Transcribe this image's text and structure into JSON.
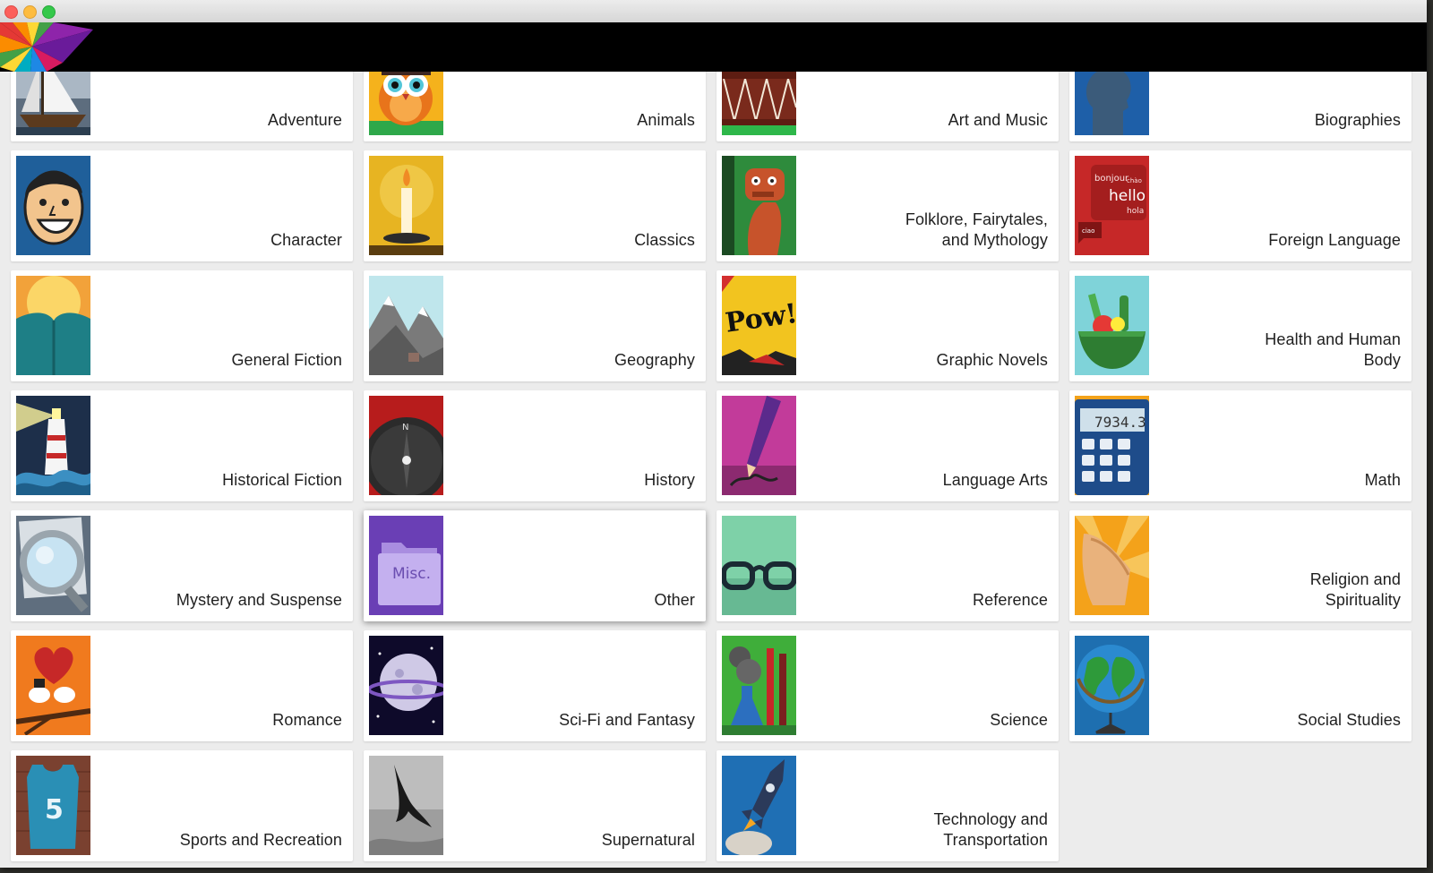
{
  "window": {
    "buttons": [
      "close",
      "minimize",
      "zoom"
    ]
  },
  "header": {
    "logo_icon": "rainbow-pinwheel-logo-icon"
  },
  "categories": [
    {
      "label": "Adventure",
      "icon": "ship-icon"
    },
    {
      "label": "Animals",
      "icon": "owl-icon"
    },
    {
      "label": "Art and Music",
      "icon": "drum-icon"
    },
    {
      "label": "Biographies",
      "icon": "head-silhouette-icon"
    },
    {
      "label": "Character",
      "icon": "smiling-face-icon"
    },
    {
      "label": "Classics",
      "icon": "candle-icon"
    },
    {
      "label": "Folklore, Fairytales,\nand Mythology",
      "icon": "dragon-icon"
    },
    {
      "label": "Foreign Language",
      "icon": "speech-bubble-hello-icon",
      "icon_words": [
        "bonjour",
        "chào",
        "hello",
        "hola",
        "ciao"
      ]
    },
    {
      "label": "General Fiction",
      "icon": "open-book-icon"
    },
    {
      "label": "Geography",
      "icon": "mountains-icon"
    },
    {
      "label": "Graphic Novels",
      "icon": "pow-comic-icon",
      "icon_text": "Pow!"
    },
    {
      "label": "Health and Human\nBody",
      "icon": "vegetable-bowl-icon"
    },
    {
      "label": "Historical Fiction",
      "icon": "lighthouse-icon"
    },
    {
      "label": "History",
      "icon": "compass-icon",
      "icon_text": "N"
    },
    {
      "label": "Language Arts",
      "icon": "pencil-icon"
    },
    {
      "label": "Math",
      "icon": "calculator-icon",
      "icon_text": "7934.3"
    },
    {
      "label": "Mystery and Suspense",
      "icon": "magnifying-glass-icon"
    },
    {
      "label": "Other",
      "icon": "misc-folder-icon",
      "icon_text": "Misc.",
      "selected": true
    },
    {
      "label": "Reference",
      "icon": "eyeglasses-icon"
    },
    {
      "label": "Religion and\nSpirituality",
      "icon": "praying-hands-icon"
    },
    {
      "label": "Romance",
      "icon": "lovebirds-heart-icon"
    },
    {
      "label": "Sci-Fi and Fantasy",
      "icon": "planet-icon"
    },
    {
      "label": "Science",
      "icon": "chemistry-flask-icon"
    },
    {
      "label": "Social Studies",
      "icon": "globe-icon"
    },
    {
      "label": "Sports and Recreation",
      "icon": "jersey-icon",
      "icon_text": "5"
    },
    {
      "label": "Supernatural",
      "icon": "bat-icon"
    },
    {
      "label": "Technology and\nTransportation",
      "icon": "rocket-icon"
    }
  ],
  "colors": {
    "topbar": "#000000",
    "tile_bg": "#ffffff",
    "page_bg": "#ececec"
  }
}
